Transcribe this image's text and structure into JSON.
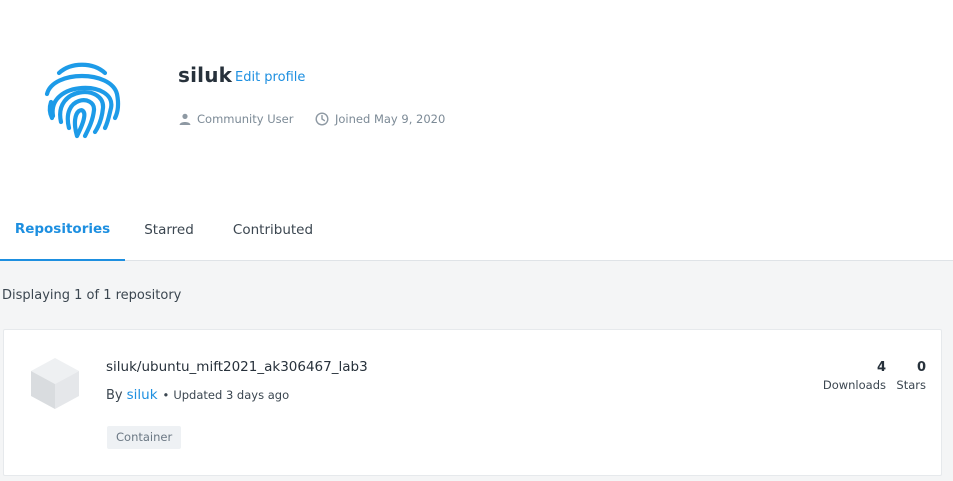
{
  "profile": {
    "username": "siluk",
    "edit_label": "Edit profile",
    "role": "Community User",
    "joined": "Joined May 9, 2020",
    "avatar_icon": "fingerprint-icon"
  },
  "tabs": [
    {
      "label": "Repositories",
      "active": true
    },
    {
      "label": "Starred",
      "active": false
    },
    {
      "label": "Contributed",
      "active": false
    }
  ],
  "listing": {
    "count_text": "Displaying 1 of 1 repository"
  },
  "repositories": [
    {
      "name": "siluk/ubuntu_mift2021_ak306467_lab3",
      "by_label": "By",
      "owner": "siluk",
      "updated": "Updated 3 days ago",
      "type_badge": "Container",
      "downloads": "4",
      "downloads_label": "Downloads",
      "stars": "0",
      "stars_label": "Stars",
      "icon": "cube-icon"
    }
  ],
  "colors": {
    "accent": "#1d8fe0",
    "text": "#27313b",
    "muted": "#7c8a96",
    "content_bg": "#f4f5f6"
  }
}
